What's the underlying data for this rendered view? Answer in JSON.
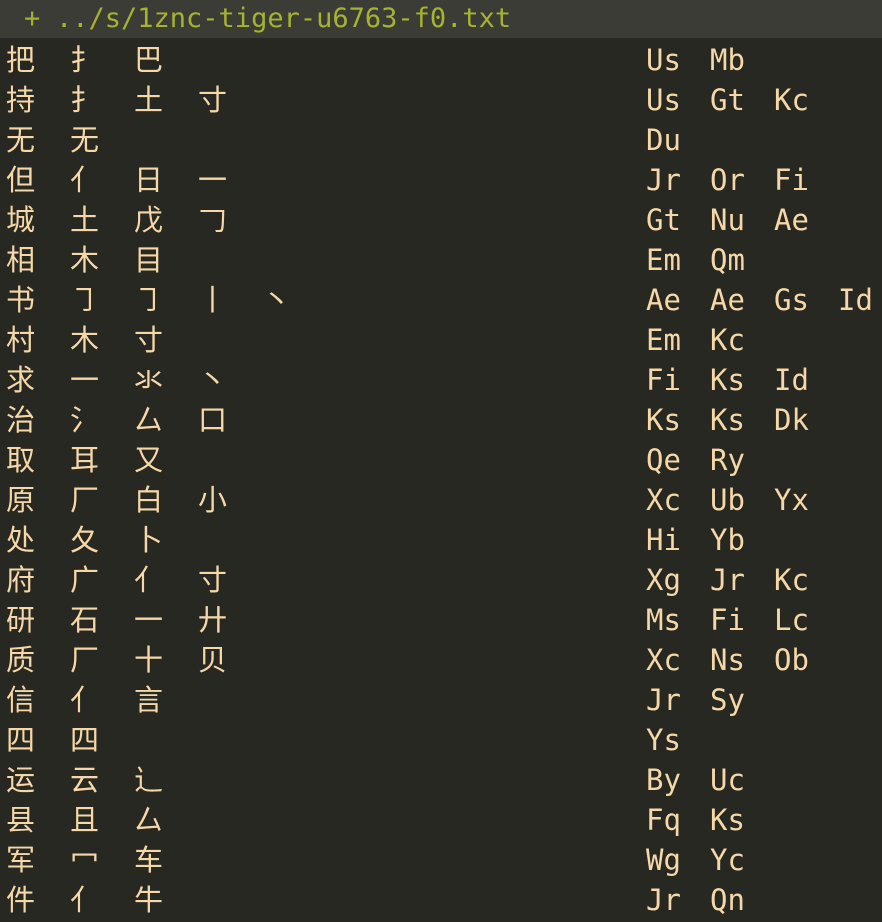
{
  "tab": {
    "marker": "+",
    "filename": "../s/1znc-tiger-u6763-f0.txt"
  },
  "colors": {
    "background": "#272822",
    "titlebar": "#3b3c36",
    "title_text": "#a6b32e",
    "body_text": "#f6d8a8"
  },
  "rows": [
    {
      "char": "把",
      "parts": [
        "扌",
        "巴"
      ],
      "codes": [
        "Us",
        "Mb"
      ]
    },
    {
      "char": "持",
      "parts": [
        "扌",
        "土",
        "寸"
      ],
      "codes": [
        "Us",
        "Gt",
        "Kc"
      ]
    },
    {
      "char": "无",
      "parts": [
        "无"
      ],
      "codes": [
        "Du"
      ]
    },
    {
      "char": "但",
      "parts": [
        "亻",
        "日",
        "一"
      ],
      "codes": [
        "Jr",
        "Or",
        "Fi"
      ]
    },
    {
      "char": "城",
      "parts": [
        "土",
        "戊",
        "𠃌"
      ],
      "codes": [
        "Gt",
        "Nu",
        "Ae"
      ]
    },
    {
      "char": "相",
      "parts": [
        "木",
        "目"
      ],
      "codes": [
        "Em",
        "Qm"
      ]
    },
    {
      "char": "书",
      "parts": [
        "㇆",
        "㇆",
        "丨",
        "丶"
      ],
      "codes": [
        "Ae",
        "Ae",
        "Gs",
        "Id"
      ]
    },
    {
      "char": "村",
      "parts": [
        "木",
        "寸"
      ],
      "codes": [
        "Em",
        "Kc"
      ]
    },
    {
      "char": "求",
      "parts": [
        "一",
        "氺",
        "丶"
      ],
      "codes": [
        "Fi",
        "Ks",
        "Id"
      ]
    },
    {
      "char": "治",
      "parts": [
        "氵",
        "厶",
        "口"
      ],
      "codes": [
        "Ks",
        "Ks",
        "Dk"
      ]
    },
    {
      "char": "取",
      "parts": [
        "耳",
        "又"
      ],
      "codes": [
        "Qe",
        "Ry"
      ]
    },
    {
      "char": "原",
      "parts": [
        "厂",
        "白",
        "小"
      ],
      "codes": [
        "Xc",
        "Ub",
        "Yx"
      ]
    },
    {
      "char": "处",
      "parts": [
        "夂",
        "卜"
      ],
      "codes": [
        "Hi",
        "Yb"
      ]
    },
    {
      "char": "府",
      "parts": [
        "广",
        "亻",
        "寸"
      ],
      "codes": [
        "Xg",
        "Jr",
        "Kc"
      ]
    },
    {
      "char": "研",
      "parts": [
        "石",
        "一",
        "廾"
      ],
      "codes": [
        "Ms",
        "Fi",
        "Lc"
      ]
    },
    {
      "char": "质",
      "parts": [
        "厂",
        "十",
        "贝"
      ],
      "codes": [
        "Xc",
        "Ns",
        "Ob"
      ]
    },
    {
      "char": "信",
      "parts": [
        "亻",
        "言"
      ],
      "codes": [
        "Jr",
        "Sy"
      ]
    },
    {
      "char": "四",
      "parts": [
        "四"
      ],
      "codes": [
        "Ys"
      ]
    },
    {
      "char": "运",
      "parts": [
        "云",
        "辶"
      ],
      "codes": [
        "By",
        "Uc"
      ]
    },
    {
      "char": "县",
      "parts": [
        "且",
        "厶"
      ],
      "codes": [
        "Fq",
        "Ks"
      ]
    },
    {
      "char": "军",
      "parts": [
        "冖",
        "车"
      ],
      "codes": [
        "Wg",
        "Yc"
      ]
    },
    {
      "char": "件",
      "parts": [
        "亻",
        "牛"
      ],
      "codes": [
        "Jr",
        "Qn"
      ]
    }
  ]
}
